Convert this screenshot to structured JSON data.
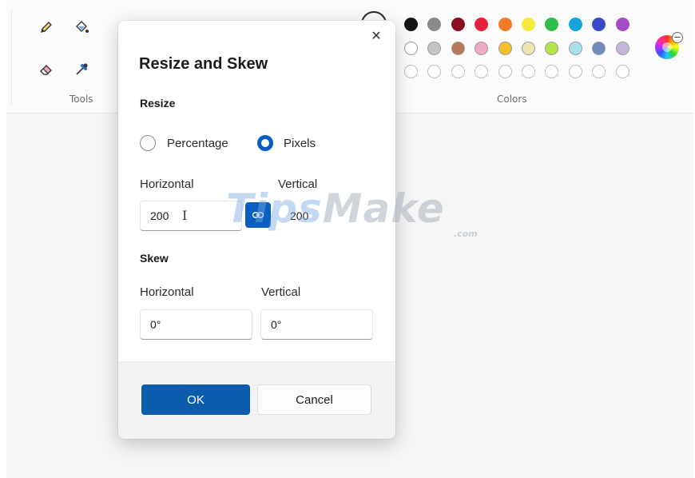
{
  "toolbar": {
    "groups": [
      {
        "label": "Tools"
      },
      {
        "label": "Colors"
      }
    ],
    "tools": [
      "pencil-icon",
      "fill-bucket-icon",
      "eraser-icon",
      "color-picker-icon"
    ],
    "colors_row1": [
      "#141414",
      "#8a8a8a",
      "#8a0f23",
      "#e3213a",
      "#f07c2a",
      "#f7e93b",
      "#2ebd4a",
      "#16a3da",
      "#3a49c7",
      "#a44cc4"
    ],
    "colors_row2": [
      "#ffffff",
      "#c4c4c4",
      "#b6785a",
      "#f1a8c6",
      "#f3bf2a",
      "#ede3b3",
      "#b5e34a",
      "#a9e1ea",
      "#6f8bbd",
      "#c6b6dc"
    ],
    "edit_colors_icon": "color-wheel-icon"
  },
  "dialog": {
    "title": "Resize and Skew",
    "close_glyph": "✕",
    "resize": {
      "heading": "Resize",
      "options": [
        {
          "label": "Percentage",
          "checked": false
        },
        {
          "label": "Pixels",
          "checked": true
        }
      ],
      "horizontal_label": "Horizontal",
      "vertical_label": "Vertical",
      "horizontal_value": "200",
      "vertical_value": "200",
      "link_icon": "link-icon"
    },
    "skew": {
      "heading": "Skew",
      "horizontal_label": "Horizontal",
      "vertical_label": "Vertical",
      "horizontal_value": "0°",
      "vertical_value": "0°"
    },
    "ok_label": "OK",
    "cancel_label": "Cancel"
  },
  "watermark": {
    "text_a": "Tips",
    "text_b": "Make",
    "suffix": ".com"
  }
}
